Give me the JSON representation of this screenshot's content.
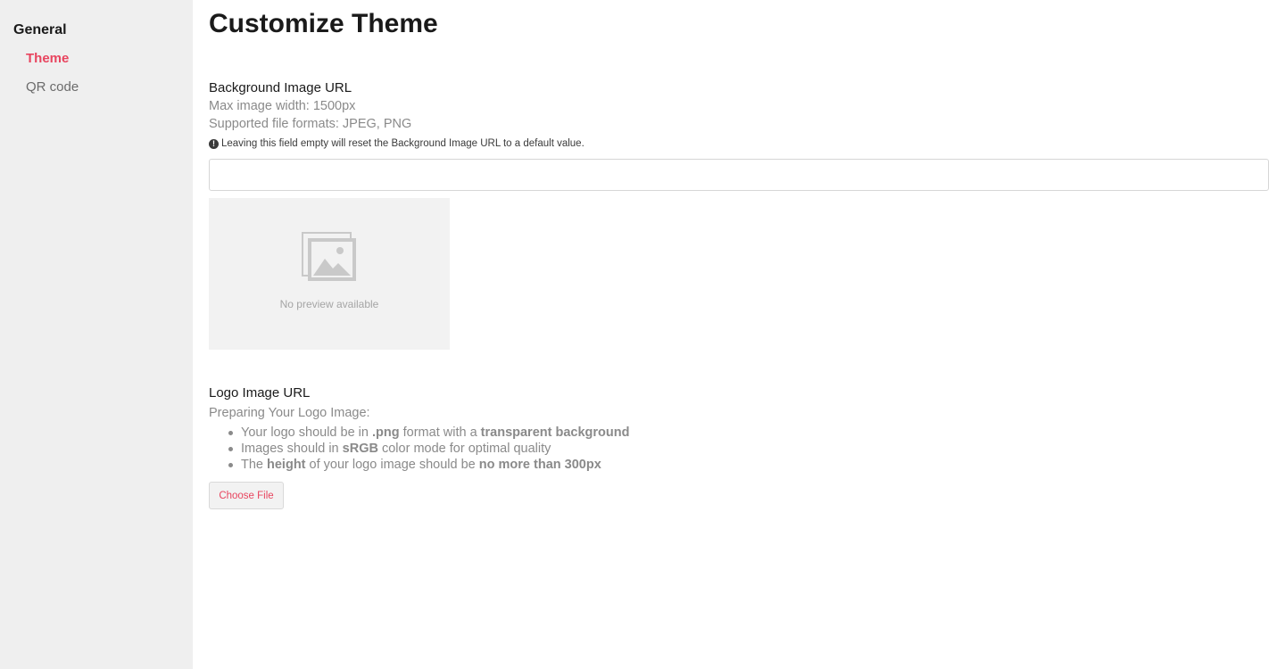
{
  "sidebar": {
    "heading": "General",
    "items": [
      {
        "label": "Theme",
        "active": true
      },
      {
        "label": "QR code",
        "active": false
      }
    ]
  },
  "page": {
    "title": "Customize Theme"
  },
  "background_image": {
    "label": "Background Image URL",
    "help": [
      "Max image width: 1500px",
      "Supported file formats: JPEG, PNG"
    ],
    "notice_icon": "exclamation-circle-icon",
    "notice": "Leaving this field empty will reset the Background Image URL to a default value.",
    "value": "",
    "placeholder": "",
    "preview": {
      "icon": "image-placeholder-icon",
      "text": "No preview available"
    }
  },
  "logo_image": {
    "label": "Logo Image URL",
    "intro": "Preparing Your Logo Image:",
    "bullets": [
      [
        {
          "t": "Your logo should be in "
        },
        {
          "t": ".png",
          "b": true
        },
        {
          "t": " format with a "
        },
        {
          "t": "transparent background",
          "b": true
        }
      ],
      [
        {
          "t": "Images should in "
        },
        {
          "t": "sRGB",
          "b": true
        },
        {
          "t": " color mode for optimal quality"
        }
      ],
      [
        {
          "t": "The "
        },
        {
          "t": "height",
          "b": true
        },
        {
          "t": " of your logo image should be "
        },
        {
          "t": "no more than 300px",
          "b": true
        }
      ]
    ],
    "button_label": "Choose File"
  },
  "colors": {
    "accent": "#e8455f",
    "sidebar_bg": "#efefef",
    "muted_text": "#8a8a8a"
  }
}
